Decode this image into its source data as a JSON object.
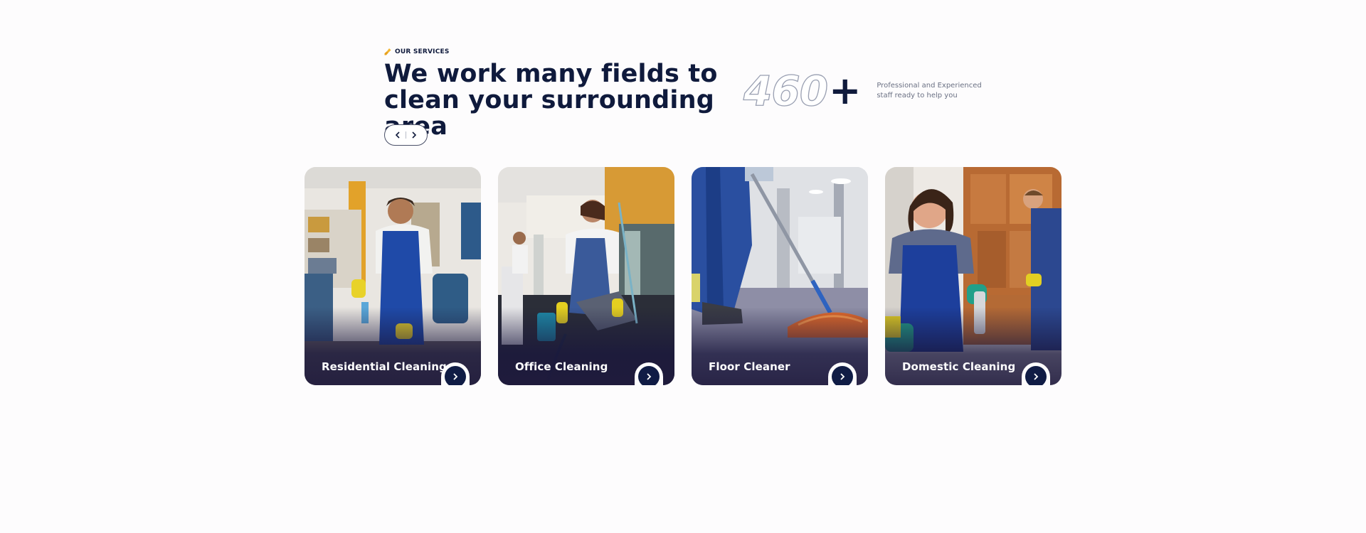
{
  "section": {
    "eyebrow": "OUR SERVICES",
    "eyebrow_icon": "broom-icon",
    "headline": "We work many fields to clean your surrounding area"
  },
  "slider_nav": {
    "prev_icon": "chevron-left-icon",
    "next_icon": "chevron-right-icon"
  },
  "stats": {
    "number": "460",
    "plus": "+",
    "description": "Professional and Experienced staff ready to help you"
  },
  "cards": [
    {
      "title": "Residential Cleaning",
      "icon": "chevron-right-icon"
    },
    {
      "title": "Office Cleaning",
      "icon": "chevron-right-icon"
    },
    {
      "title": "Floor Cleaner",
      "icon": "chevron-right-icon"
    },
    {
      "title": "Domestic Cleaning",
      "icon": "chevron-right-icon"
    }
  ],
  "colors": {
    "navy": "#0f1a3c",
    "button": "#101c45",
    "accent_yellow": "#f2b531",
    "background": "#fdfcfd"
  }
}
